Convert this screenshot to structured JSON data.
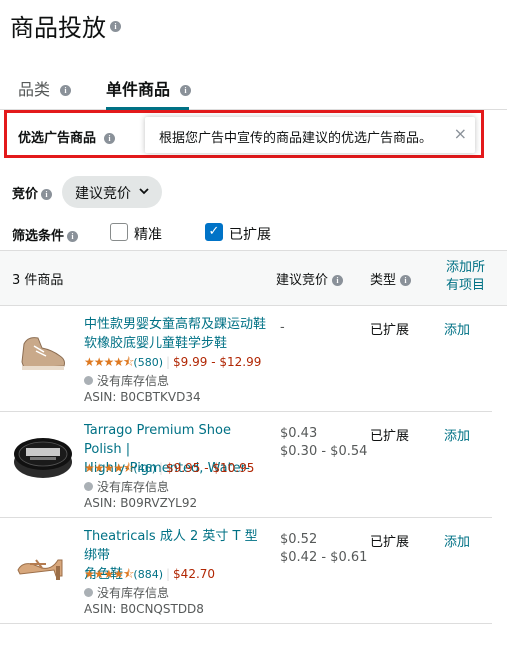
{
  "page": {
    "title": "商品投放"
  },
  "tabs": [
    {
      "label": "品类"
    },
    {
      "label": "单件商品"
    }
  ],
  "callout": {
    "label": "优选广告商品",
    "tooltip": "根据您广告中宣传的商品建议的优选广告商品。",
    "close_glyph": "×"
  },
  "bid": {
    "label": "竞价",
    "select_value": "建议竞价"
  },
  "filter": {
    "label": "筛选条件",
    "exact_label": "精准",
    "exact_checked": false,
    "expanded_label": "已扩展",
    "expanded_checked": true
  },
  "table": {
    "count_label": "3 件商品",
    "col_suggested_bid": "建议竞价",
    "col_type": "类型",
    "add_all_line1": "添加所",
    "add_all_line2": "有项目"
  },
  "products": [
    {
      "name_line1": "中性款男婴女童高帮及踝运动鞋",
      "name_line2": "软橡胶底婴儿童鞋学步鞋",
      "stars": "★★★★⯪",
      "rating_value": 4.5,
      "reviews": "(580)",
      "price": "$9.99 - $12.99",
      "stock": "没有库存信息",
      "asin": "ASIN: B0CBTKVD34",
      "bid_line1": "-",
      "bid_line2": "",
      "type": "已扩展",
      "add": "添加",
      "thumb_icon": "baby-sneaker-icon"
    },
    {
      "name_line1": "Tarrago Premium Shoe Polish |",
      "name_line2": "Highly-Pigmented, Water-",
      "stars": "★★★★⯪",
      "rating_value": 4.5,
      "reviews": "(46)",
      "price": "$9.95 - $10.95",
      "stock": "没有库存信息",
      "asin": "ASIN: B09RVZYL92",
      "bid_line1": "$0.43",
      "bid_line2": "$0.30 - $0.54",
      "type": "已扩展",
      "add": "添加",
      "thumb_icon": "shoe-polish-tin-icon"
    },
    {
      "name_line1": "Theatricals 成人 2 英寸 T 型绑带",
      "name_line2": "角色鞋",
      "stars": "★★★★⯪",
      "rating_value": 4.5,
      "reviews": "(884)",
      "price": "$42.70",
      "stock": "没有库存信息",
      "asin": "ASIN: B0CNQSTDD8",
      "bid_line1": "$0.52",
      "bid_line2": "$0.42 - $0.61",
      "type": "已扩展",
      "add": "添加",
      "thumb_icon": "character-shoe-icon"
    }
  ],
  "colors": {
    "accent": "#007185",
    "highlight_border": "#e3191b",
    "star": "#de7921",
    "price": "#b12704",
    "checkbox": "#0073c7"
  }
}
